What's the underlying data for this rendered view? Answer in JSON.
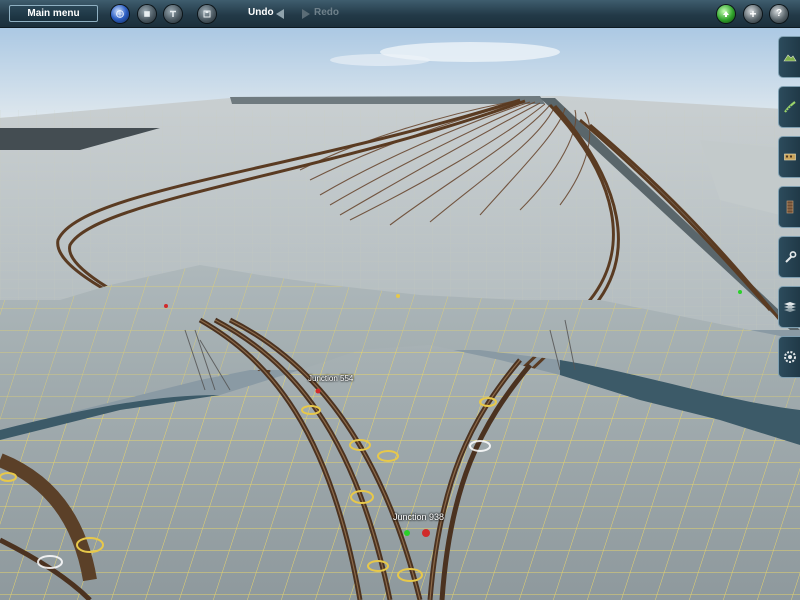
{
  "toolbar": {
    "main_menu_label": "Main menu",
    "undo_label": "Undo",
    "redo_label": "Redo"
  },
  "toolbar_icons_left": [
    "globe-icon",
    "stop-icon",
    "info-icon",
    "save-icon"
  ],
  "toolbar_icons_right": [
    "up-arrow-icon",
    "plus-icon",
    "help-icon"
  ],
  "right_tabs": [
    {
      "name": "terrain-tool-tab",
      "icon": "terrain-icon"
    },
    {
      "name": "track-tool-tab",
      "icon": "track-icon"
    },
    {
      "name": "objects-tool-tab",
      "icon": "objects-icon"
    },
    {
      "name": "trackside-tool-tab",
      "icon": "trackside-icon"
    },
    {
      "name": "topology-tool-tab",
      "icon": "wrench-icon"
    },
    {
      "name": "layers-tool-tab",
      "icon": "layers-icon"
    },
    {
      "name": "settings-tool-tab",
      "icon": "gear-icon"
    }
  ],
  "scene": {
    "junction_labels": [
      "Junction 554",
      "Junction 938"
    ]
  },
  "colors": {
    "toolbar_bg": "#233a48",
    "tab_border": "#7fa0b2",
    "sky_top": "#a9c7e2",
    "terrain": "#9aa5a8",
    "grid_yellow": "#e7d36a",
    "track_brown": "#5a3b22"
  }
}
